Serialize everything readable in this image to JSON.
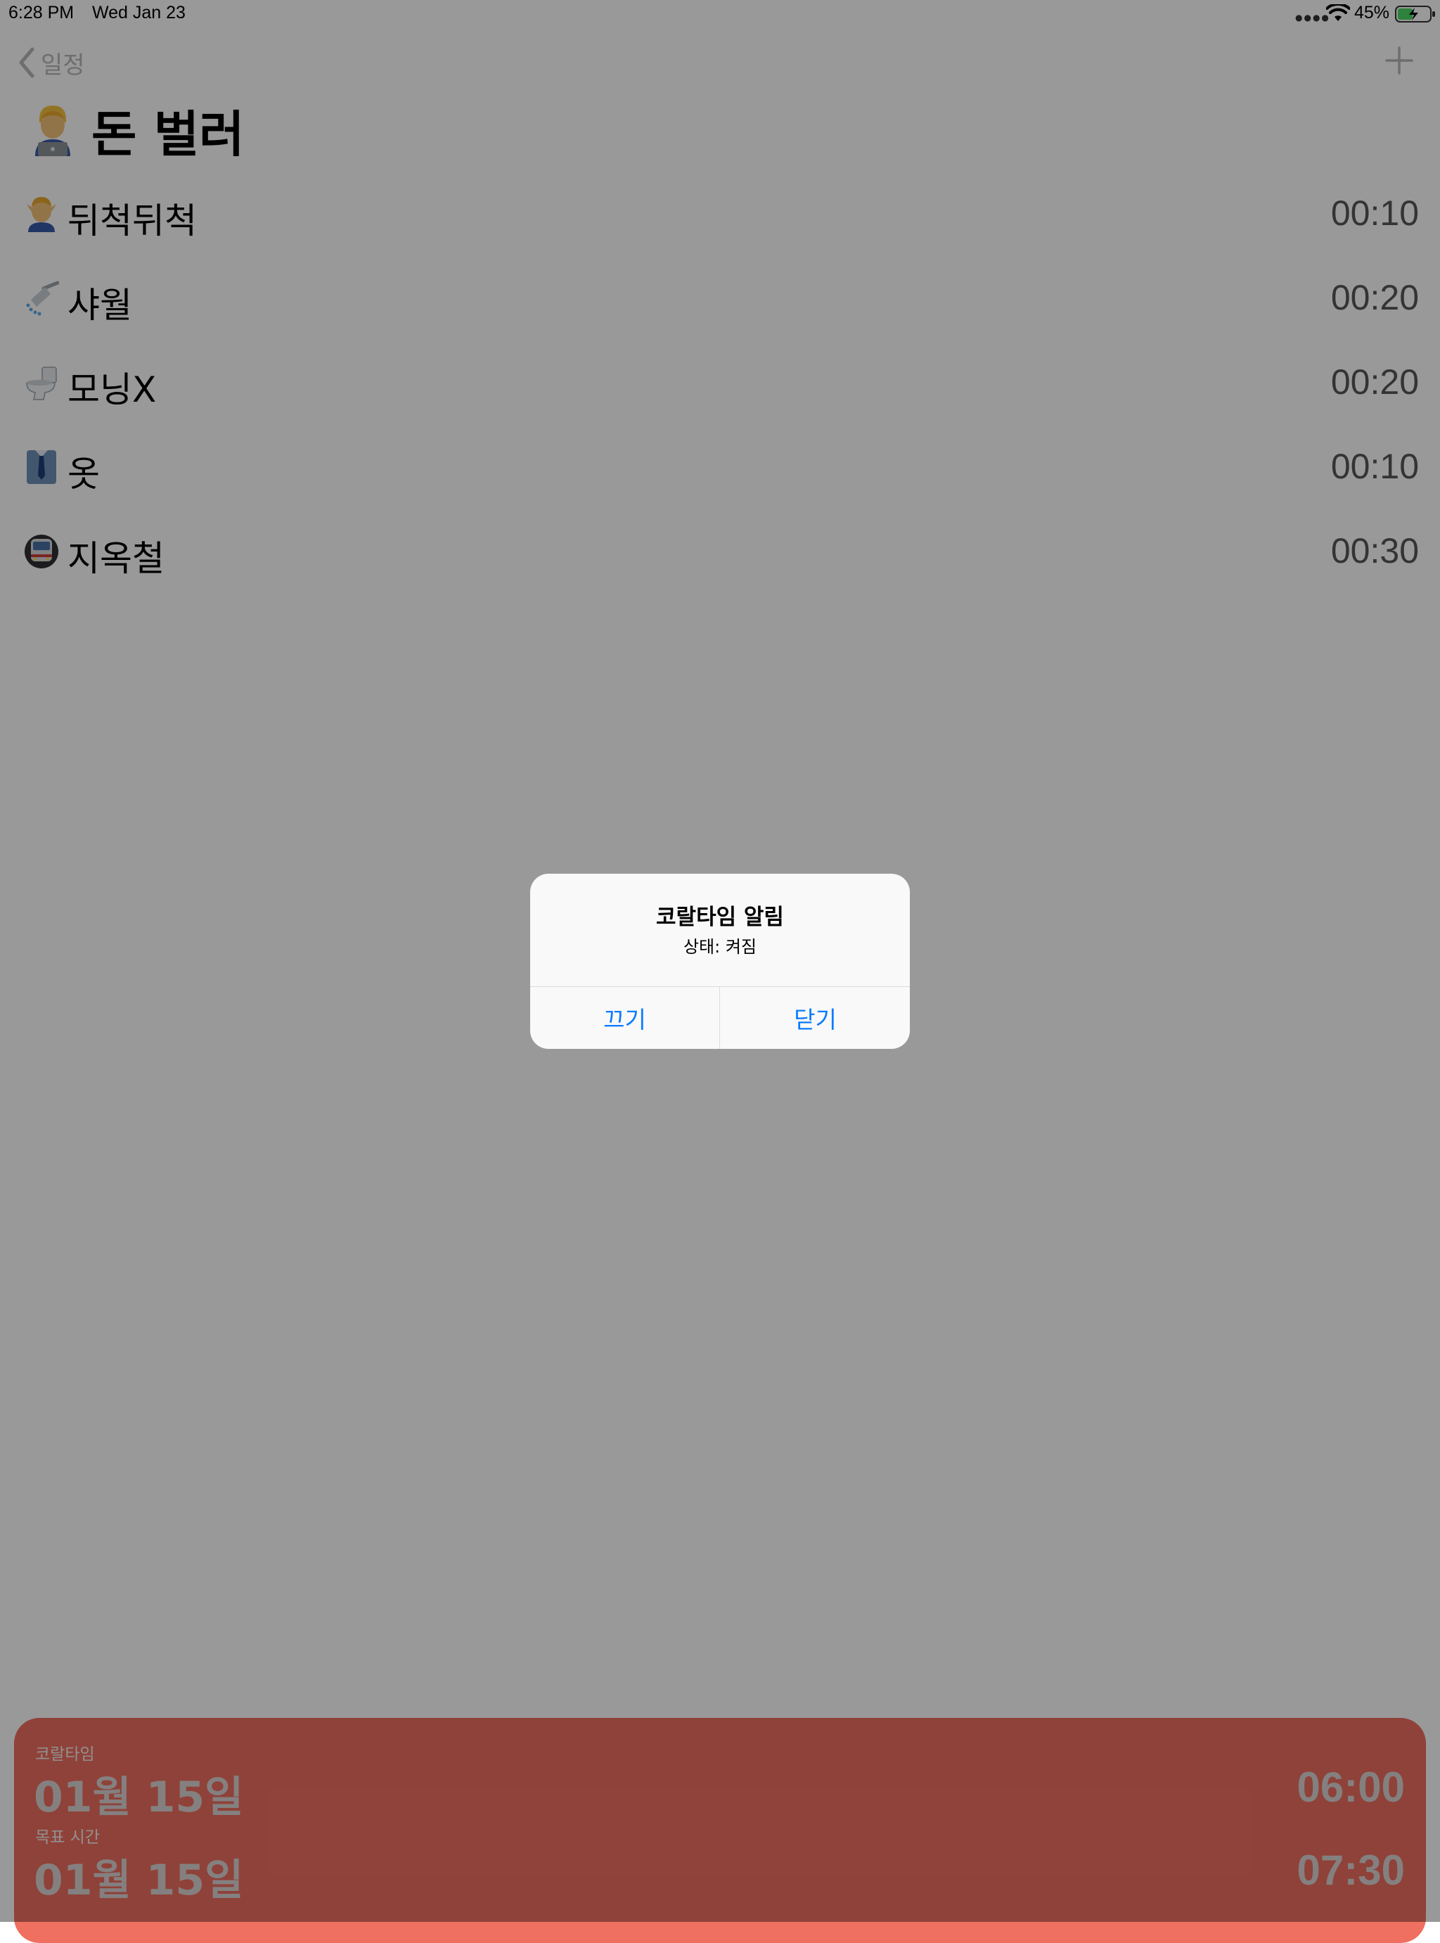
{
  "status_bar": {
    "time": "6:28 PM",
    "date": "Wed Jan 23",
    "battery": "45%",
    "signal_icon": "signal-dots-icon",
    "wifi_icon": "wifi-icon",
    "battery_icon": "battery-charging-icon"
  },
  "nav": {
    "back_label": "일정",
    "back_icon": "chevron-left-icon",
    "add_icon": "plus-icon"
  },
  "title": {
    "emoji_icon": "technologist-emoji-icon",
    "text": "돈 벌러"
  },
  "tasks": [
    {
      "icon": "person-getting-massage-emoji-icon",
      "name": "뒤척뒤척",
      "duration": "00:10"
    },
    {
      "icon": "shower-emoji-icon",
      "name": "샤월",
      "duration": "00:20"
    },
    {
      "icon": "toilet-emoji-icon",
      "name": "모닝X",
      "duration": "00:20"
    },
    {
      "icon": "necktie-shirt-emoji-icon",
      "name": "옷",
      "duration": "00:10"
    },
    {
      "icon": "metro-emoji-icon",
      "name": "지옥철",
      "duration": "00:30"
    }
  ],
  "bottom_card": {
    "color": "#ef6f60",
    "rows": [
      {
        "label": "코랄타임",
        "date": "01월 15일",
        "time": "06:00"
      },
      {
        "label": "목표 시간",
        "date": "01월 15일",
        "time": "07:30"
      }
    ]
  },
  "alert": {
    "title": "코랄타임 알림",
    "message": "상태: 켜짐",
    "buttons": [
      {
        "label": "끄기"
      },
      {
        "label": "닫기"
      }
    ],
    "button_color": "#0a7aff"
  }
}
